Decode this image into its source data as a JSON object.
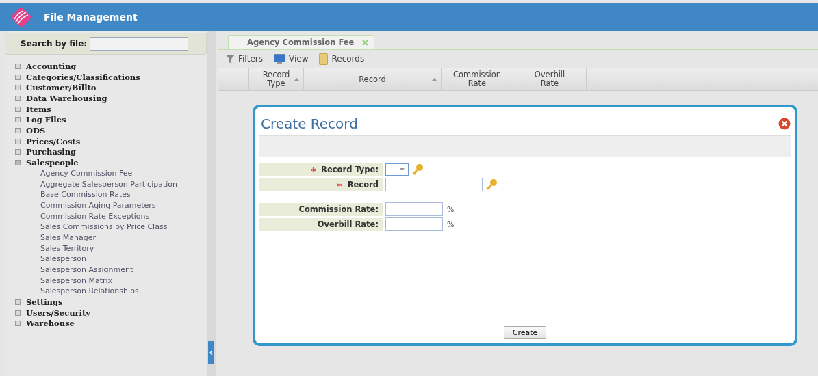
{
  "header": {
    "title": "File Management"
  },
  "search": {
    "label": "Search by file:"
  },
  "tree": [
    {
      "label": "Accounting",
      "expanded": false
    },
    {
      "label": "Categories/Classifications",
      "expanded": false
    },
    {
      "label": "Customer/Billto",
      "expanded": false
    },
    {
      "label": "Data Warehousing",
      "expanded": false
    },
    {
      "label": "Items",
      "expanded": false
    },
    {
      "label": "Log Files",
      "expanded": false
    },
    {
      "label": "ODS",
      "expanded": false
    },
    {
      "label": "Prices/Costs",
      "expanded": false
    },
    {
      "label": "Purchasing",
      "expanded": false
    },
    {
      "label": "Salespeople",
      "expanded": true,
      "children": [
        {
          "label": "Agency Commission Fee"
        },
        {
          "label": "Aggregate Salesperson Participation"
        },
        {
          "label": "Base Commission Rates"
        },
        {
          "label": "Commission Aging Parameters"
        },
        {
          "label": "Commission Rate Exceptions"
        },
        {
          "label": "Sales Commissions by Price Class"
        },
        {
          "label": "Sales Manager"
        },
        {
          "label": "Sales Territory"
        },
        {
          "label": "Salesperson"
        },
        {
          "label": "Salesperson Assignment"
        },
        {
          "label": "Salesperson Matrix"
        },
        {
          "label": "Salesperson Relationships"
        }
      ]
    },
    {
      "label": "Settings",
      "expanded": false
    },
    {
      "label": "Users/Security",
      "expanded": false
    },
    {
      "label": "Warehouse",
      "expanded": false
    }
  ],
  "tabs": [
    {
      "label": "Agency Commission Fee",
      "selected": true
    }
  ],
  "toolbar": [
    {
      "kind": "filter",
      "label": "Filters"
    },
    {
      "kind": "view",
      "label": "View"
    },
    {
      "kind": "records",
      "label": "Records"
    }
  ],
  "table": {
    "columns": [
      {
        "label": "Record Type",
        "sortable": true
      },
      {
        "label": "Record",
        "sortable": true
      },
      {
        "label": "Commission Rate",
        "sortable": false
      },
      {
        "label": "Overbill Rate",
        "sortable": false
      }
    ]
  },
  "dialog": {
    "title": "Create Record",
    "field_groups": [
      [
        {
          "label": "Record Type:",
          "required": true,
          "kind": "select",
          "lookup": true
        },
        {
          "label": "Record",
          "required": true,
          "kind": "text",
          "lookup": true
        }
      ],
      [
        {
          "label": "Commission Rate:",
          "kind": "short",
          "suffix": "%"
        },
        {
          "label": "Overbill Rate:",
          "kind": "short",
          "suffix": "%"
        }
      ]
    ],
    "button": "Create"
  }
}
